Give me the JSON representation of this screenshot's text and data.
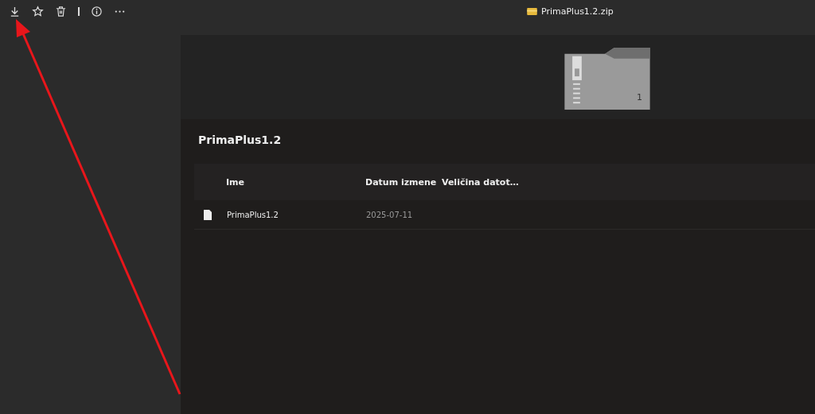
{
  "toolbar": {
    "title": "PrimaPlus1.2.zip"
  },
  "preview": {
    "count": "1"
  },
  "folder": {
    "title": "PrimaPlus1.2"
  },
  "table": {
    "columns": [
      "Ime",
      "Datum izmene",
      "Veličina datot…"
    ],
    "rows": [
      {
        "name": "PrimaPlus1.2",
        "date": "2025-07-11"
      }
    ]
  }
}
